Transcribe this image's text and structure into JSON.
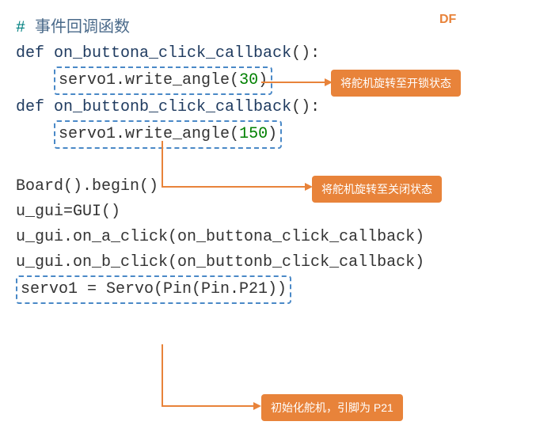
{
  "watermark": "DF",
  "code": {
    "comment_hash": "#",
    "comment_text": " 事件回调函数",
    "def1": "def",
    "func_a": " on_buttona_click_callback",
    "paren_empty": "():",
    "line_a_body_prefix": "servo1.write_angle(",
    "line_a_num": "30",
    "line_a_body_suffix": ")",
    "def2": "def",
    "func_b": " on_buttonb_click_callback",
    "paren_empty2": "():",
    "line_b_body_prefix": "servo1.write_angle(",
    "line_b_num": "150",
    "line_b_body_suffix": ")",
    "board_line": "Board().begin()",
    "gui_line": "u_gui=GUI()",
    "on_a_line": "u_gui.on_a_click(on_buttona_click_callback)",
    "on_b_line": "u_gui.on_b_click(on_buttonb_click_callback)",
    "servo_line": "servo1 = Servo(Pin(Pin.P21))"
  },
  "annotations": {
    "open_state": "将舵机旋转至开锁状态",
    "close_state": "将舵机旋转至关闭状态",
    "init_servo": "初始化舵机，引脚为 P21"
  }
}
